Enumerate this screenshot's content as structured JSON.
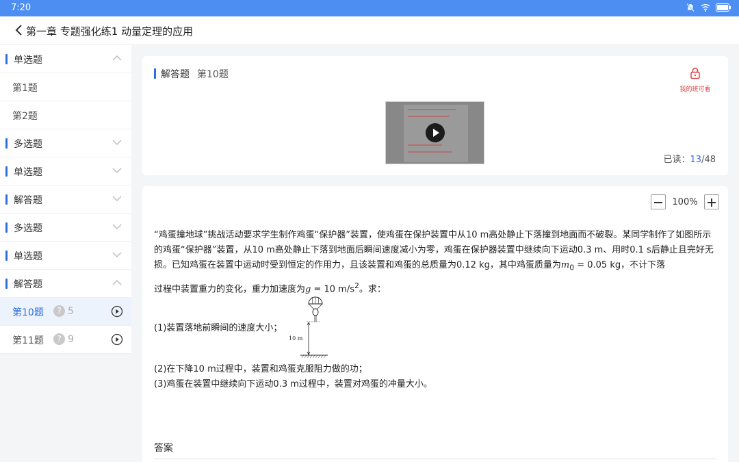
{
  "status": {
    "time": "7:20"
  },
  "header": {
    "title": "第一章 专题强化练1   动量定理的应用"
  },
  "sidebar": {
    "sections": [
      {
        "label": "单选题",
        "expanded": true,
        "items": [
          {
            "label": "第1题"
          },
          {
            "label": "第2题"
          }
        ]
      },
      {
        "label": "多选题",
        "expanded": false
      },
      {
        "label": "单选题",
        "expanded": false
      },
      {
        "label": "解答题",
        "expanded": false
      },
      {
        "label": "多选题",
        "expanded": false
      },
      {
        "label": "单选题",
        "expanded": false
      },
      {
        "label": "解答题",
        "expanded": true,
        "items": [
          {
            "label": "第10题",
            "question_count": "5",
            "active": true
          },
          {
            "label": "第11题",
            "question_count": "9",
            "active": false
          }
        ]
      }
    ]
  },
  "question_header": {
    "type": "解答题",
    "number": "第10题",
    "lock_label": "我的班可看",
    "read_label": "已读：",
    "read_count": "13",
    "read_total": "/48"
  },
  "zoom": {
    "level": "100%"
  },
  "question": {
    "intro_1": "“鸡蛋撞地球”挑战活动要求学生制作鸡蛋“保护器”装置，使鸡蛋在保护装置中从10 m高处静止下落撞到地面而不破裂。某同学制作了如图所示的鸡蛋“保护器”装置，从10 m高处静止下落到地面后瞬间速度减小为零，鸡蛋在保护器装置中继续向下运动0.3 m、用时0.1 s后静止且完好无损。已知鸡蛋在装置中运动时受到恒定的作用力，且该装置和鸡蛋的总质量为0.12 kg，其中鸡蛋质量为",
    "m0_symbol": "m",
    "m0_sub": "0",
    "m0_value": " = 0.05 kg，不计下落",
    "intro_2": "过程中装置重力的变化，重力加速度为",
    "g_symbol": "g",
    "g_value": " = 10 m/s",
    "g_exp": "2",
    "g_tail": "。求：",
    "figure_label": "10 m",
    "sub_1": "(1)装置落地前瞬间的速度大小；",
    "sub_2": "(2)在下降10 m过程中，装置和鸡蛋克服阻力做的功；",
    "sub_3": "(3)鸡蛋在装置中继续向下运动0.3 m过程中，装置对鸡蛋的冲量大小。"
  },
  "answer": {
    "label": "答案"
  }
}
